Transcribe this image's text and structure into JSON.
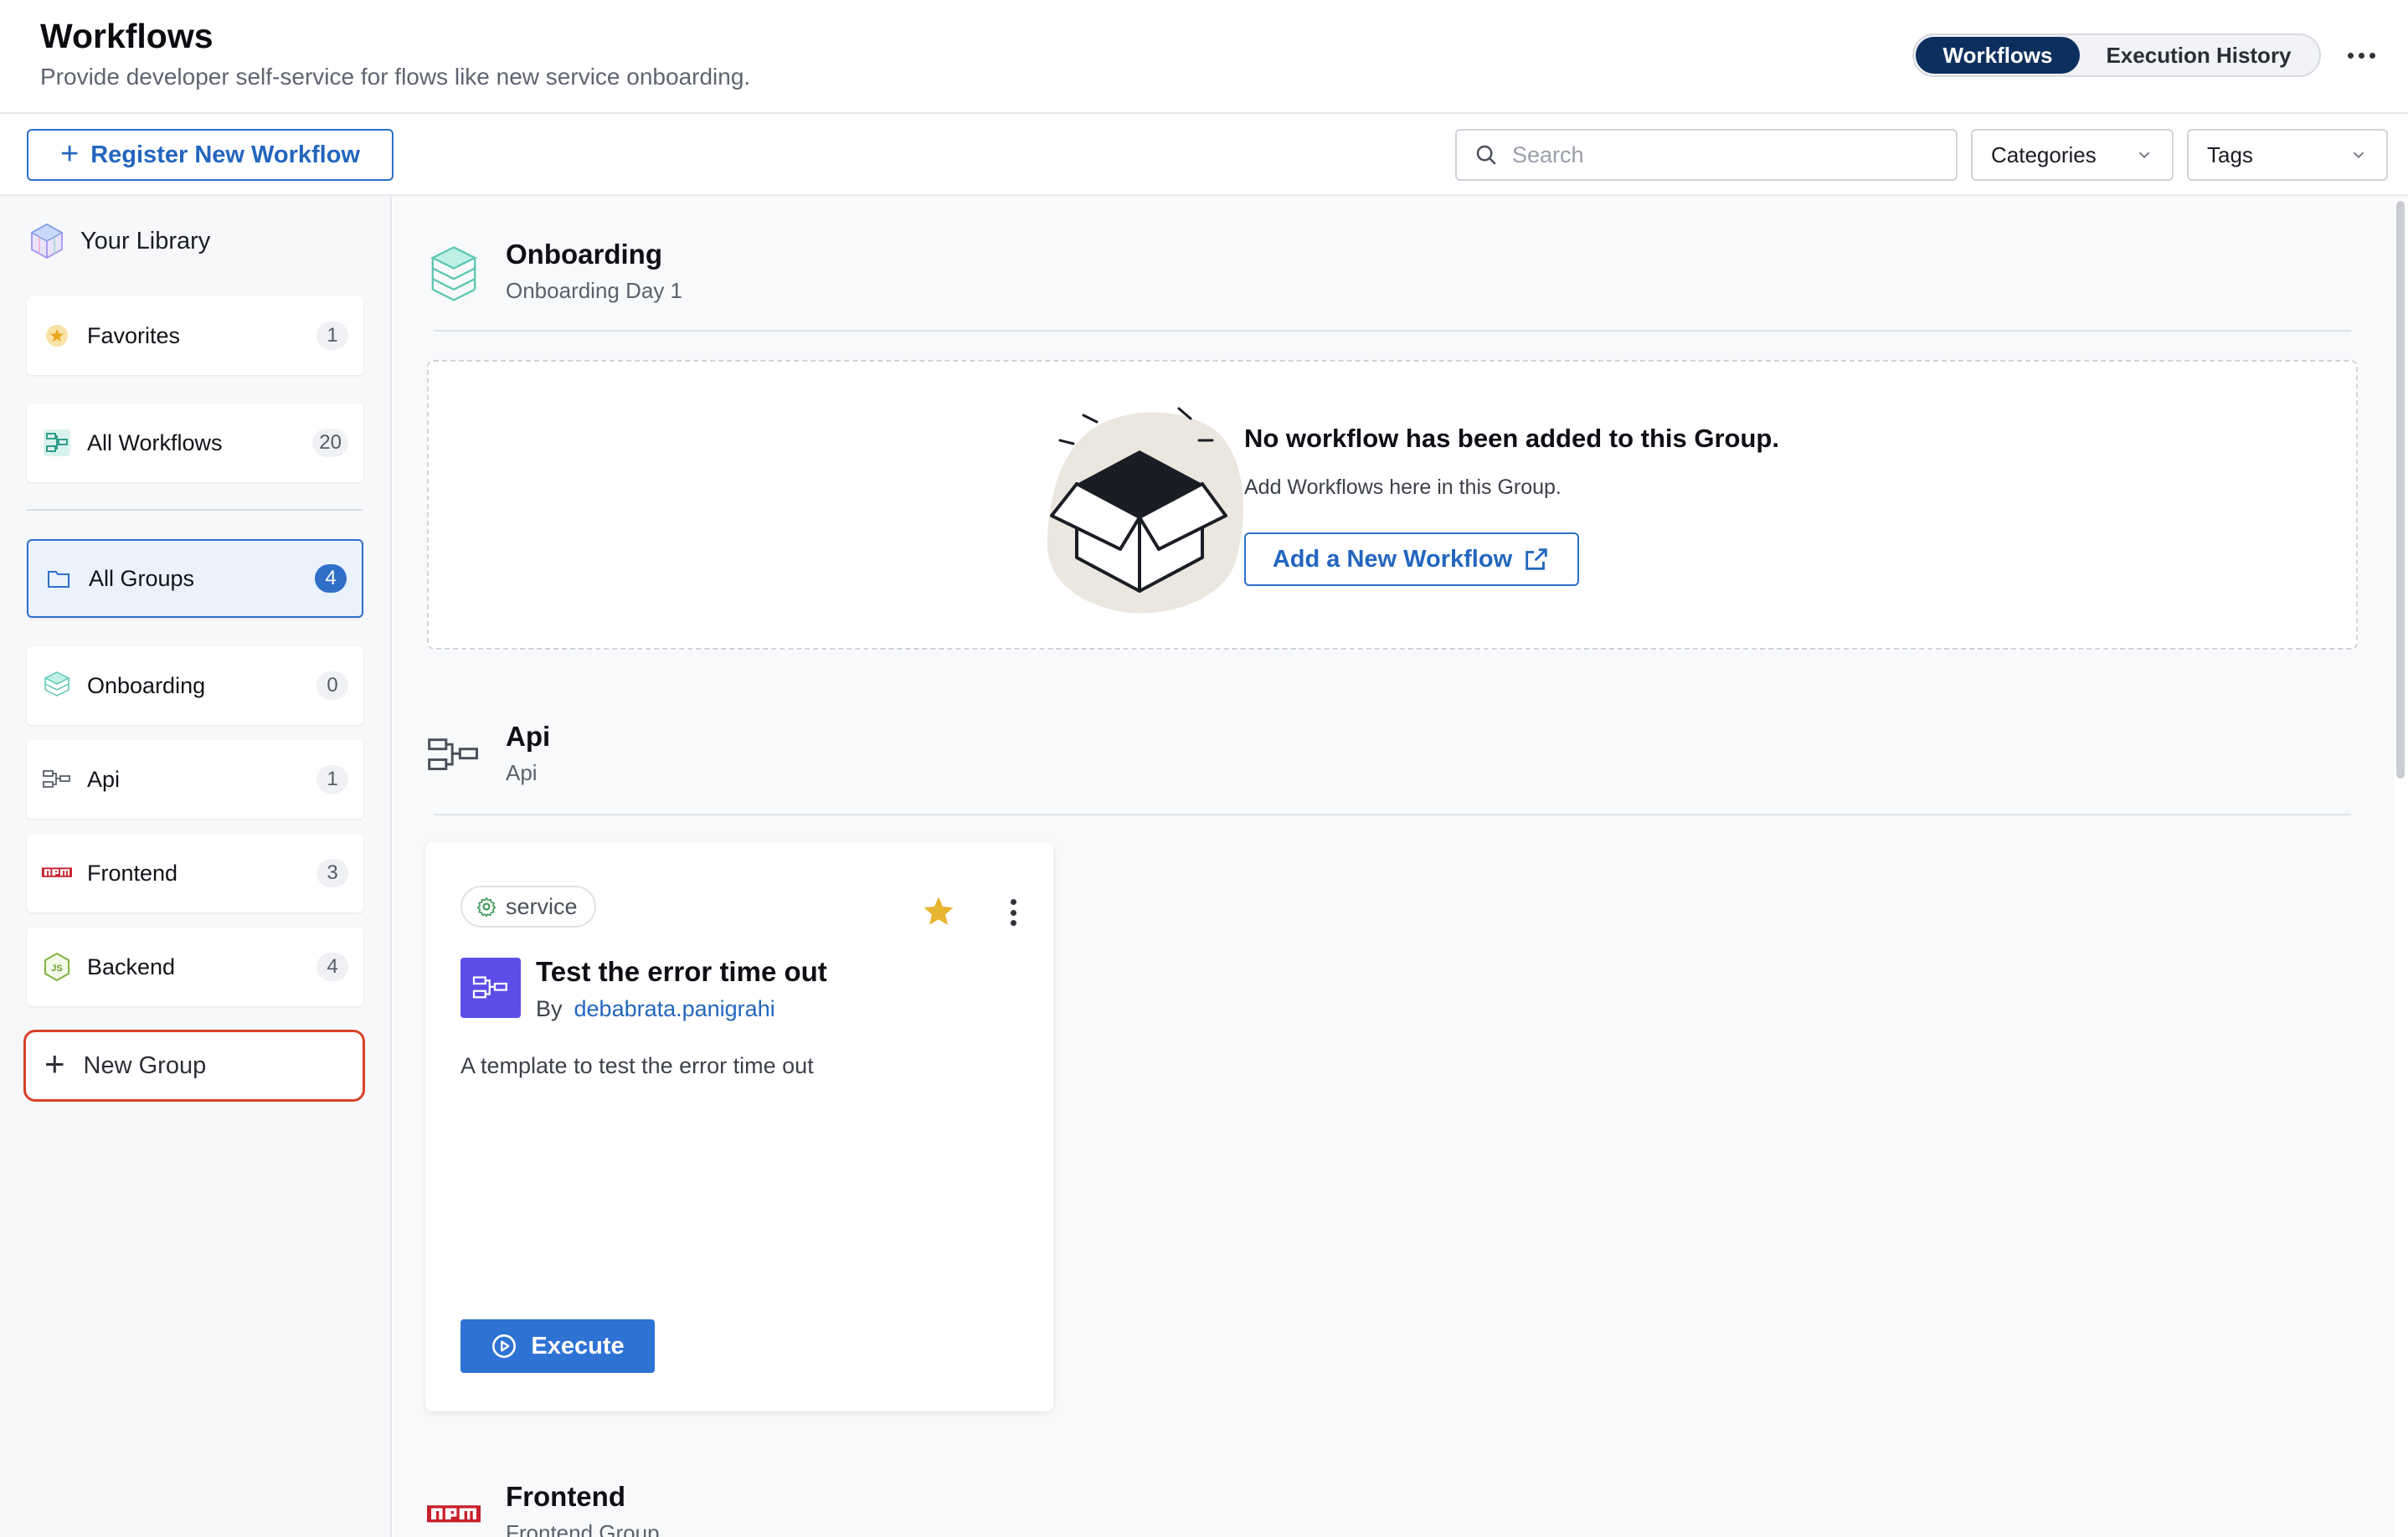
{
  "header": {
    "title": "Workflows",
    "subtitle": "Provide developer self-service for flows like new service onboarding.",
    "toggle": {
      "active_label": "Workflows",
      "inactive_label": "Execution History"
    }
  },
  "toolbar": {
    "register_label": "Register New Workflow",
    "search_placeholder": "Search",
    "categories_label": "Categories",
    "tags_label": "Tags"
  },
  "sidebar": {
    "library_title": "Your Library",
    "items": [
      {
        "label": "Favorites",
        "count": "1",
        "icon": "star-badge-icon"
      },
      {
        "label": "All Workflows",
        "count": "20",
        "icon": "workflows-icon"
      },
      {
        "label": "All Groups",
        "count": "4",
        "icon": "folder-icon",
        "selected": true
      },
      {
        "label": "Onboarding",
        "count": "0",
        "icon": "stack-icon"
      },
      {
        "label": "Api",
        "count": "1",
        "icon": "api-icon"
      },
      {
        "label": "Frontend",
        "count": "3",
        "icon": "npm-icon"
      },
      {
        "label": "Backend",
        "count": "4",
        "icon": "nodejs-icon"
      }
    ],
    "new_group_label": "New Group"
  },
  "groups": [
    {
      "name": "Onboarding",
      "description": "Onboarding Day 1",
      "empty": {
        "title": "No workflow has been added to this Group.",
        "text": "Add Workflows here in this Group.",
        "button": "Add a New Workflow"
      }
    },
    {
      "name": "Api",
      "description": "Api",
      "workflows": [
        {
          "tag": "service",
          "title": "Test the error time out",
          "by_label": "By",
          "author": "debabrata.panigrahi",
          "description": "A template to test the error time out",
          "favorited": true,
          "execute_label": "Execute"
        }
      ]
    },
    {
      "name": "Frontend",
      "description": "Frontend Group"
    }
  ],
  "colors": {
    "brand_blue": "#2e70c8",
    "toggle_active": "#0d2f5e",
    "highlight_red": "#d9412a",
    "star_gold": "#e8b530",
    "workflow_icon_bg": "#5b4ee8"
  }
}
